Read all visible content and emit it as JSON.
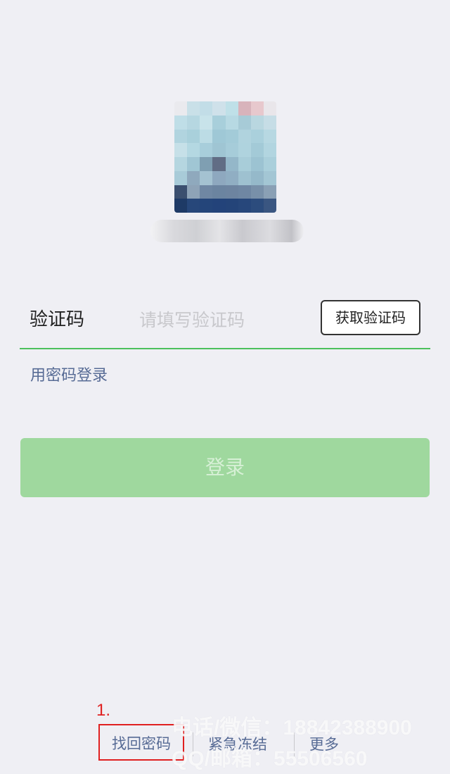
{
  "avatar_pixels": [
    [
      "#eaeaee",
      "#c9e0e8",
      "#c2dde7",
      "#cfe1ea",
      "#bfe0e8",
      "#d8b3bb",
      "#e7c8cd",
      "#e9e6ea"
    ],
    [
      "#bfdee7",
      "#b6d7e1",
      "#c8e3ea",
      "#a8cfdb",
      "#b7d9e3",
      "#a7cbd7",
      "#b9d7e0",
      "#c6dde6"
    ],
    [
      "#b1d4df",
      "#a9d0db",
      "#bcdce5",
      "#9fc8d6",
      "#a3cbd8",
      "#b0d3de",
      "#aad0dc",
      "#b7d8e2"
    ],
    [
      "#c6e0e8",
      "#b4d8e2",
      "#a8cedb",
      "#9fc5d3",
      "#a6ccd9",
      "#afd3de",
      "#a3cad7",
      "#b2d5e0"
    ],
    [
      "#b5d6e0",
      "#a0c6d4",
      "#7f9fb2",
      "#616d85",
      "#94b7c9",
      "#a8cdd9",
      "#9cc3d2",
      "#aacfdb"
    ],
    [
      "#a8cbd8",
      "#8fa9bd",
      "#a4c2d1",
      "#8ea8bf",
      "#90aec3",
      "#9ec1d0",
      "#95b9ca",
      "#a3c6d4"
    ],
    [
      "#3b4f6f",
      "#8ea3b7",
      "#6f87a3",
      "#6b84a0",
      "#6d84a0",
      "#6f87a3",
      "#7890a9",
      "#8aa0b5"
    ],
    [
      "#1e3a66",
      "#27477a",
      "#24457a",
      "#23437a",
      "#244479",
      "#27477b",
      "#2c4c7d",
      "#3a5681"
    ]
  ],
  "login": {
    "field_label": "验证码",
    "field_placeholder": "请填写验证码",
    "get_code_button": "获取验证码",
    "switch_to_password": "用密码登录",
    "login_button": "登录"
  },
  "annotation": {
    "number": "1."
  },
  "bottom": {
    "find_password": "找回密码",
    "emergency_freeze": "紧急冻结",
    "more": "更多"
  },
  "watermark": {
    "line1": "电话/微信：18842388900",
    "line2": "QQ/邮箱：55506560"
  },
  "colors": {
    "accent_green": "#4cc05c",
    "login_button_disabled": "#9fd89e",
    "link_blue": "#576b95",
    "annotation_red": "#e02020",
    "background": "#efeff4"
  }
}
